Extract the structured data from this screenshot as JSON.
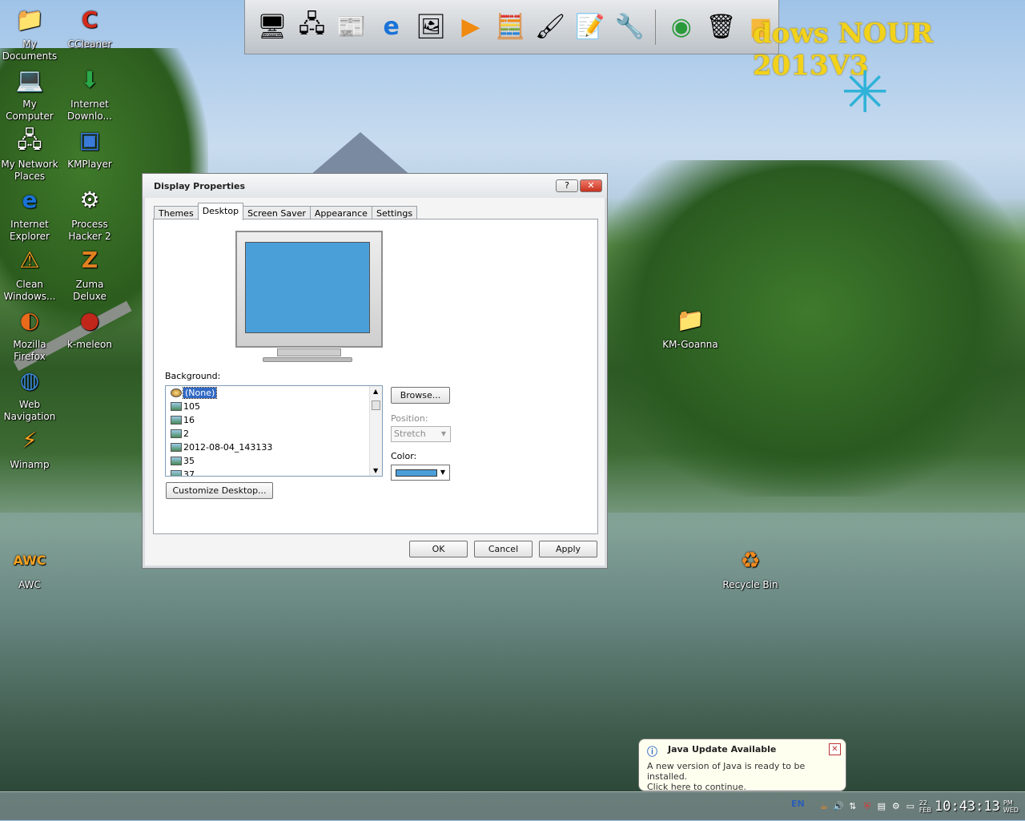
{
  "dock": {
    "icons": [
      "monitor-icon",
      "network-icon",
      "documents-icon",
      "internet-explorer-icon",
      "media-icon",
      "play-icon",
      "calculator-icon",
      "paint-icon",
      "notepad-icon",
      "utility-icon",
      "chrome-icon",
      "recycle-icon",
      "folder-icon"
    ]
  },
  "brand": {
    "text": "dows NOUR 2013V3"
  },
  "desktop": {
    "icons": [
      {
        "label": "My Documents"
      },
      {
        "label": "CCleaner"
      },
      {
        "label": "My Computer"
      },
      {
        "label": "Internet Downlo..."
      },
      {
        "label": "My Network Places"
      },
      {
        "label": "KMPlayer"
      },
      {
        "label": "Internet Explorer"
      },
      {
        "label": "Process Hacker 2"
      },
      {
        "label": "Clean Windows..."
      },
      {
        "label": "Zuma Deluxe"
      },
      {
        "label": "Mozilla Firefox"
      },
      {
        "label": "k-meleon"
      },
      {
        "label": "Web Navigation"
      },
      {
        "label": "Winamp"
      },
      {
        "label": "AWC"
      },
      {
        "label": "KM-Goanna"
      },
      {
        "label": "Recycle Bin"
      }
    ]
  },
  "dialog": {
    "title": "Display Properties",
    "help_label": "?",
    "close_label": "✕",
    "tabs": [
      {
        "label": "Themes"
      },
      {
        "label": "Desktop"
      },
      {
        "label": "Screen Saver"
      },
      {
        "label": "Appearance"
      },
      {
        "label": "Settings"
      }
    ],
    "active_tab": "Desktop",
    "background_label": "Background:",
    "backgrounds": [
      {
        "label": "(None)"
      },
      {
        "label": "105"
      },
      {
        "label": "16"
      },
      {
        "label": "2"
      },
      {
        "label": "2012-08-04_143133"
      },
      {
        "label": "35"
      },
      {
        "label": "37"
      }
    ],
    "selected_background": "(None)",
    "browse_label": "Browse...",
    "position_label": "Position:",
    "position_value": "Stretch",
    "color_label": "Color:",
    "color_value": "#4a9fd9",
    "customize_label": "Customize Desktop...",
    "ok_label": "OK",
    "cancel_label": "Cancel",
    "apply_label": "Apply"
  },
  "notification": {
    "title": "Java Update Available",
    "line1": "A new version of Java is ready to be installed.",
    "line2": "Click here to continue."
  },
  "taskbar": {
    "language": "EN",
    "date_day": "22",
    "date_month": "FEB",
    "time": "10:43:13",
    "period": "PM",
    "weekday": "WED"
  }
}
